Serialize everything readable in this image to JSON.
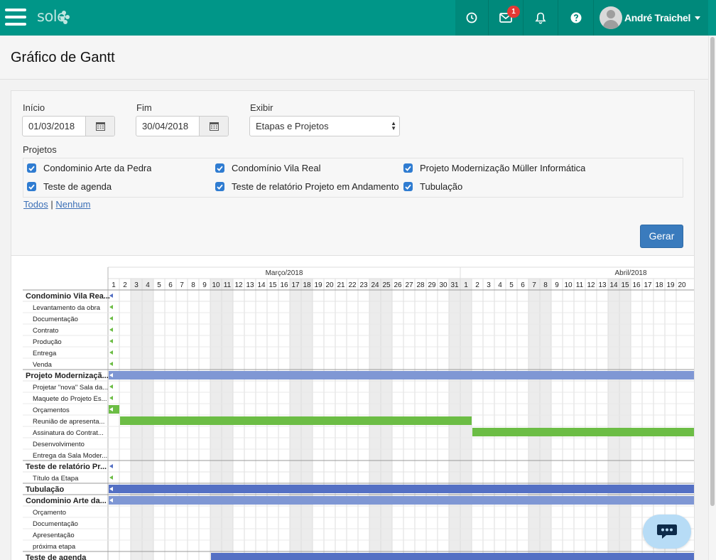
{
  "header": {
    "logo_text": "sole",
    "notification_count": "1",
    "user_name": "André Traichel"
  },
  "page": {
    "title": "Gráfico de Gantt"
  },
  "filters": {
    "start_label": "Início",
    "start_value": "01/03/2018",
    "end_label": "Fim",
    "end_value": "30/04/2018",
    "show_label": "Exibir",
    "show_value": "Etapas e Projetos",
    "projects_label": "Projetos",
    "projects": [
      "Condominio Arte da Pedra",
      "Condomínio Vila Real",
      "Projeto Modernização Müller Informática",
      "Teste de agenda",
      "Teste de relatório Projeto em Andamento",
      "Tubulação"
    ],
    "all_link": "Todos",
    "link_separator": "|",
    "none_link": "Nenhum",
    "generate_button": "Gerar"
  },
  "gantt": {
    "months": [
      "Março/2018",
      "Abril/2018"
    ],
    "march_days": 31,
    "april_days_visible": 20,
    "march_weekend_days": [
      3,
      4,
      10,
      11,
      17,
      18,
      24,
      25,
      31
    ],
    "april_weekend_days": [
      1,
      7,
      8,
      14,
      15
    ],
    "colors": {
      "project_bar": "#7f97d4",
      "project_bar_dark": "#5470c4",
      "task_bar": "#6cbd45",
      "weekend": "#ececec",
      "grid": "#dcdcdc"
    },
    "rows": [
      {
        "label": "Condominio Vila Rea...",
        "type": "project"
      },
      {
        "label": "Levantamento da obra",
        "type": "task"
      },
      {
        "label": "Documentação",
        "type": "task"
      },
      {
        "label": "Contrato",
        "type": "task"
      },
      {
        "label": "Produção",
        "type": "task"
      },
      {
        "label": "Entrega",
        "type": "task"
      },
      {
        "label": "Venda",
        "type": "task"
      },
      {
        "label": "Projeto Modernizaçã...",
        "type": "project",
        "bar": {
          "start": 1,
          "end": 52,
          "color": "project_bar"
        }
      },
      {
        "label": "Projetar \"nova\" Sala da...",
        "type": "task"
      },
      {
        "label": "Maquete do Projeto Es...",
        "type": "task"
      },
      {
        "label": "Orçamentos",
        "type": "task",
        "bar": {
          "start": 1,
          "end": 1,
          "color": "task_bar"
        }
      },
      {
        "label": "Reunião de apresenta...",
        "type": "task",
        "bar": {
          "start": 2,
          "end": 32,
          "color": "task_bar"
        }
      },
      {
        "label": "Assinatura do Contrat...",
        "type": "task",
        "bar": {
          "start": 33,
          "end": 52,
          "color": "task_bar"
        }
      },
      {
        "label": "Desenvolvimento",
        "type": "task"
      },
      {
        "label": "Entrega da Sala Moder...",
        "type": "task"
      },
      {
        "label": "Teste de relatório Pr...",
        "type": "project"
      },
      {
        "label": "Título da Etapa",
        "type": "task"
      },
      {
        "label": "Tubulação",
        "type": "project",
        "bar": {
          "start": 1,
          "end": 52,
          "color": "project_bar_dark"
        }
      },
      {
        "label": "Condominio Arte da...",
        "type": "project",
        "bar": {
          "start": 1,
          "end": 52,
          "color": "project_bar"
        }
      },
      {
        "label": "Orçamento",
        "type": "task"
      },
      {
        "label": "Documentação",
        "type": "task"
      },
      {
        "label": "Apresentação",
        "type": "task"
      },
      {
        "label": "próxima etapa",
        "type": "task"
      },
      {
        "label": "Teste de agenda",
        "type": "project",
        "bar": {
          "start": 10,
          "end": 52,
          "color": "project_bar_dark"
        }
      }
    ],
    "start_markers": [
      0,
      1,
      2,
      3,
      4,
      5,
      6,
      8,
      9,
      15,
      16
    ]
  }
}
